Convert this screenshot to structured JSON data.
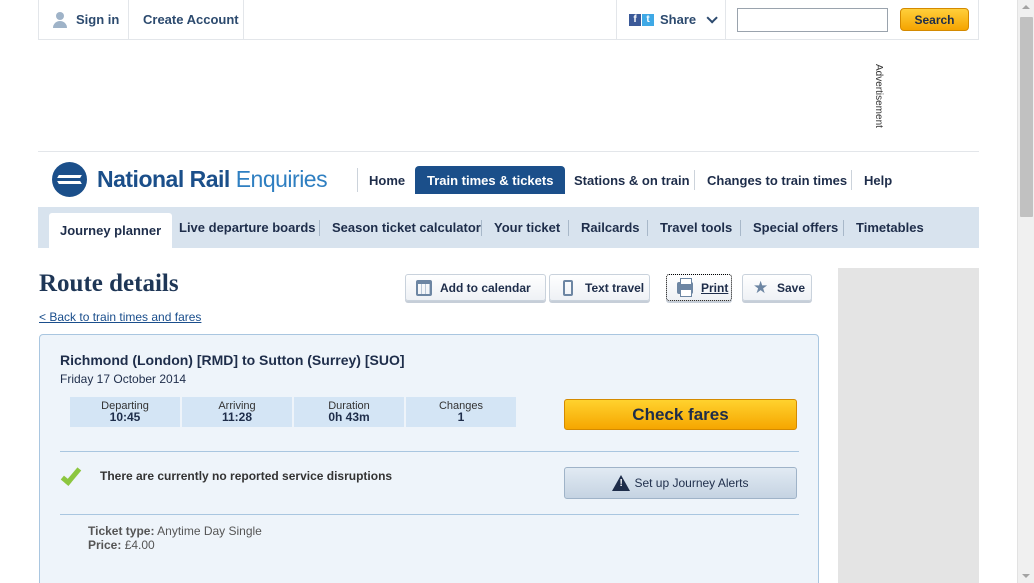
{
  "topbar": {
    "sign_in": "Sign in",
    "create_account": "Create Account",
    "share": "Share",
    "search_value": "",
    "search_button": "Search"
  },
  "advertisement_label": "Advertisement",
  "logo": {
    "part1": "National Rail",
    "part2": "Enquiries"
  },
  "main_nav": [
    "Home",
    "Train times & tickets",
    "Stations & on train",
    "Changes to train times",
    "Help"
  ],
  "sub_nav": [
    "Journey planner",
    "Live departure boards",
    "Season ticket calculator",
    "Your ticket",
    "Railcards",
    "Travel tools",
    "Special offers",
    "Timetables"
  ],
  "page": {
    "title": "Route details",
    "back_link": "< Back to train times and fares",
    "actions": {
      "calendar": "Add to calendar",
      "text": "Text travel",
      "print": "Print",
      "save": "Save"
    }
  },
  "journey": {
    "route": "Richmond (London) [RMD] to Sutton (Surrey) [SUO]",
    "date": "Friday 17 October 2014",
    "stats": [
      {
        "label": "Departing",
        "value": "10:45"
      },
      {
        "label": "Arriving",
        "value": "11:28"
      },
      {
        "label": "Duration",
        "value": "0h 43m"
      },
      {
        "label": "Changes",
        "value": "1"
      }
    ],
    "check_fares": "Check fares",
    "disruption": "There are currently no reported service disruptions",
    "alerts_button": "Set up Journey Alerts",
    "ticket_type_label": "Ticket type:",
    "ticket_type": "Anytime Day Single",
    "price_label": "Price:",
    "price": "£4.00"
  },
  "colors": {
    "brand": "#1b4f8a",
    "accent": "#f6a600",
    "success": "#8cc63f"
  }
}
